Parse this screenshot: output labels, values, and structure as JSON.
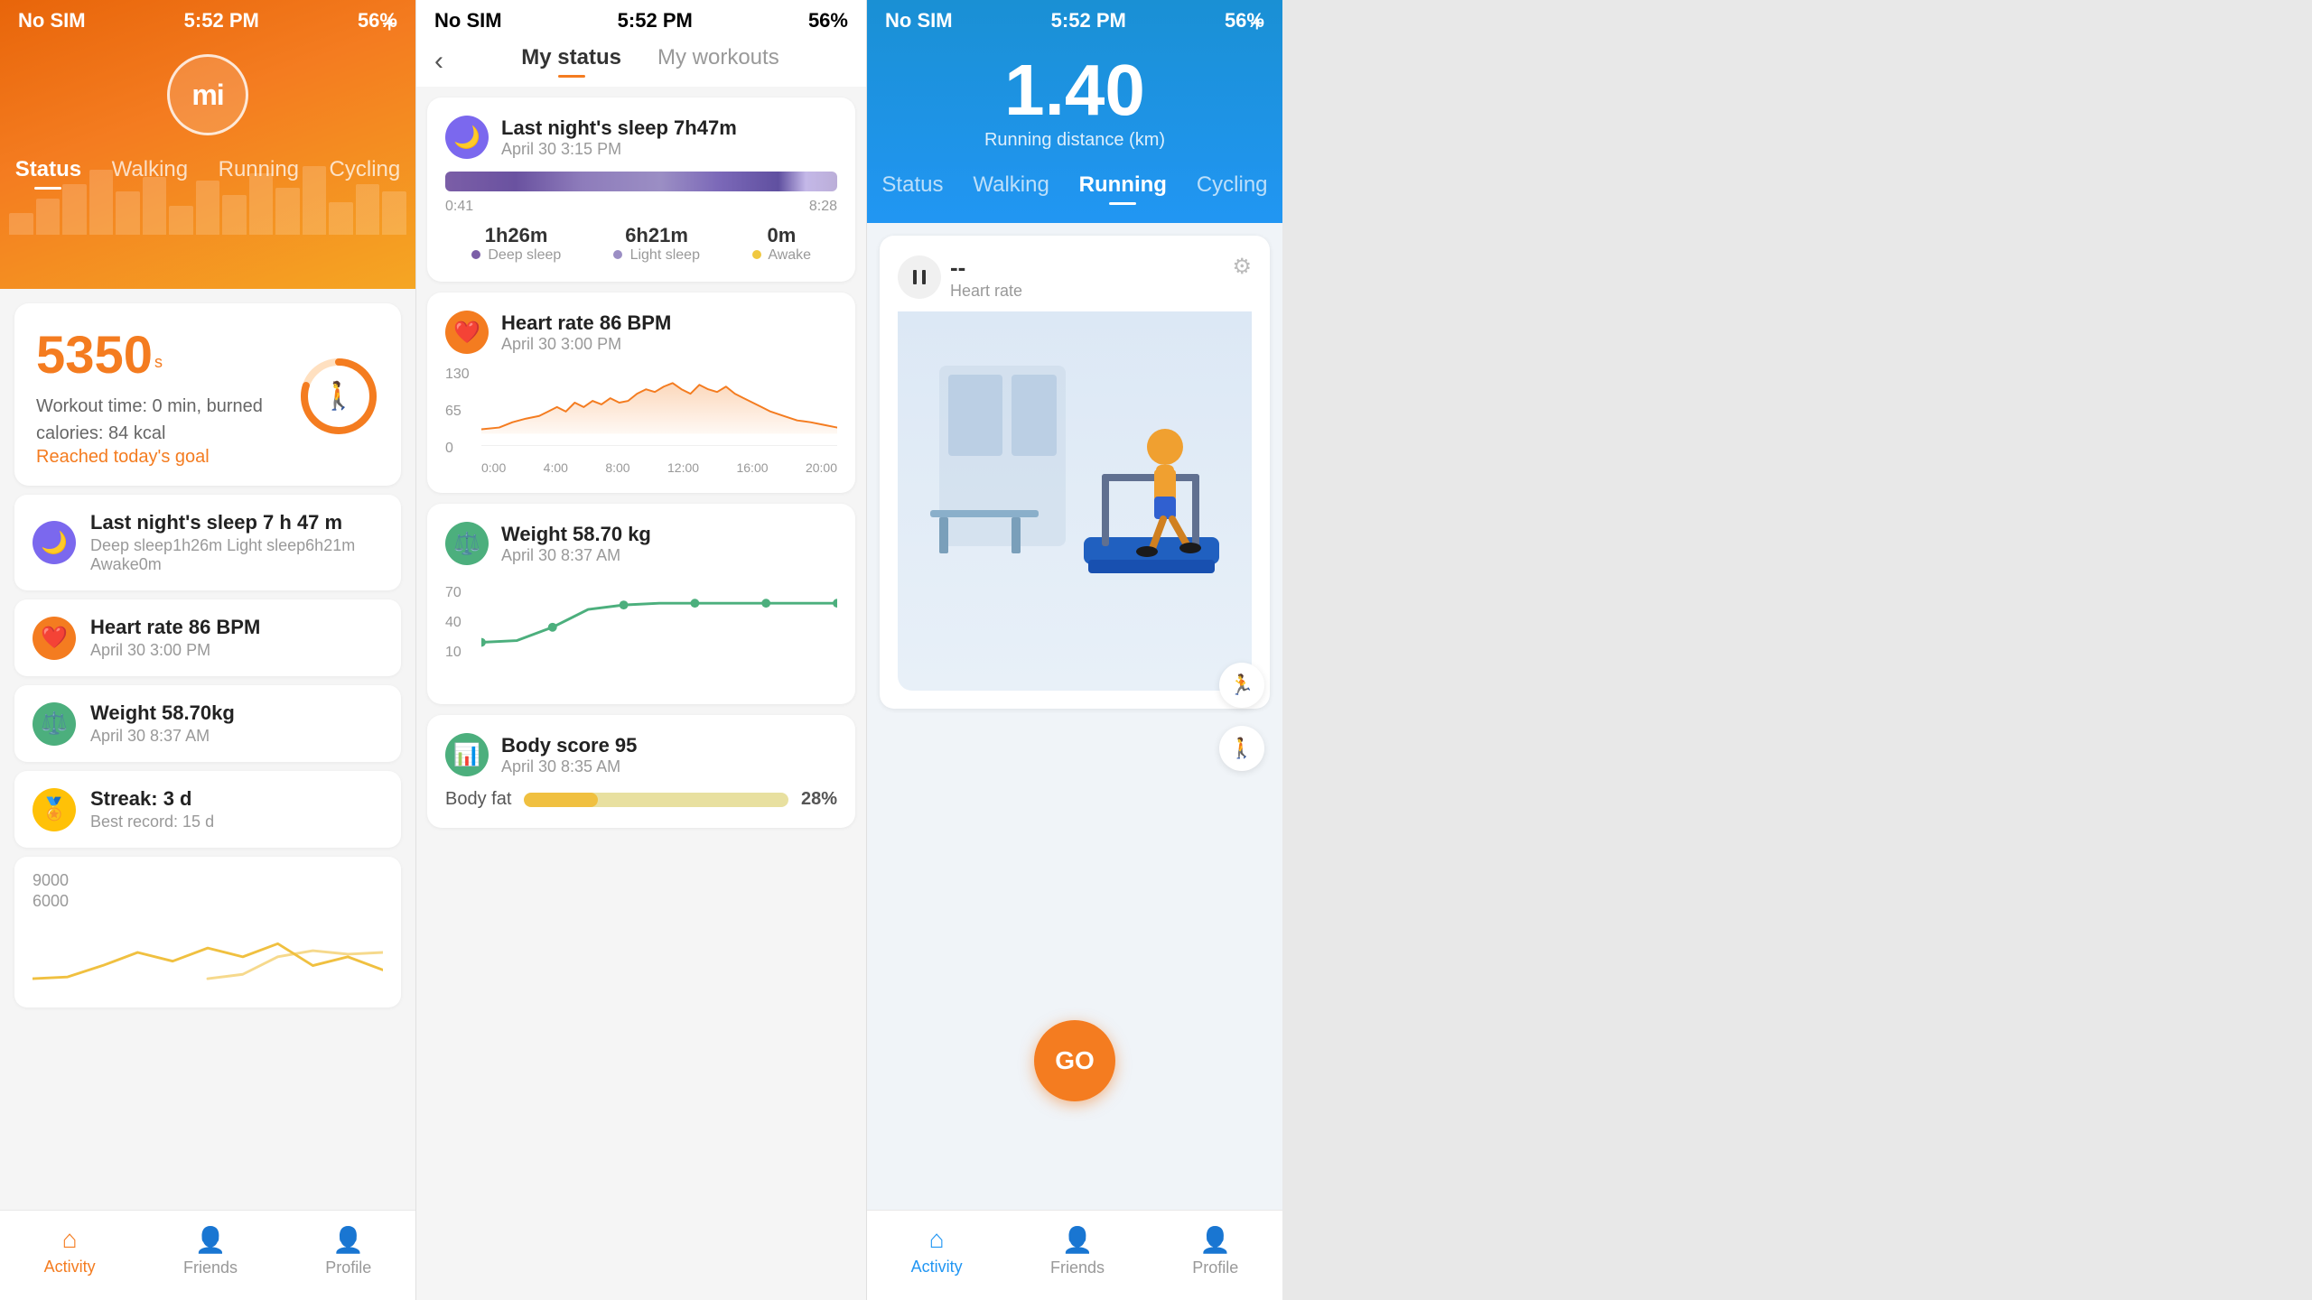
{
  "statusBar": {
    "carrier": "No SIM",
    "time": "5:52 PM",
    "batteryPct": "56%"
  },
  "panel1": {
    "logo": "mi",
    "addIcon": "+",
    "tabs": [
      "Status",
      "Walking",
      "Running",
      "Cycling"
    ],
    "activeTab": "Status",
    "steps": {
      "count": "5350",
      "unit": "s",
      "workoutInfo": "Workout time: 0 min, burned calories: 84 kcal",
      "goal": "Reached today's goal",
      "ringProgress": 80
    },
    "sleepItem": {
      "title": "Last night's sleep 7 h 47 m",
      "sub": "Deep sleep1h26m Light sleep6h21m Awake0m"
    },
    "heartItem": {
      "title": "Heart rate 86 BPM",
      "sub": "April 30 3:00 PM"
    },
    "weightItem": {
      "title": "Weight 58.70kg",
      "sub": "April 30 8:37 AM"
    },
    "streakItem": {
      "title": "Streak: 3 d",
      "sub": "Best record: 15 d"
    },
    "chartLabels": [
      "9000",
      "6000"
    ],
    "nav": {
      "activity": "Activity",
      "friends": "Friends",
      "profile": "Profile"
    }
  },
  "panel2": {
    "title": "My status",
    "tab2": "My workouts",
    "sleep": {
      "title": "Last night's sleep 7h47m",
      "date": "April 30 3:15 PM",
      "timeStart": "0:41",
      "timeEnd": "8:28",
      "deepSleep": "1h26m",
      "lightSleep": "6h21m",
      "awake": "0m",
      "deepLabel": "Deep sleep",
      "lightLabel": "Light sleep",
      "awakeLabel": "Awake"
    },
    "heartRate": {
      "title": "Heart rate 86  BPM",
      "date": "April 30 3:00 PM",
      "yLabels": [
        "130",
        "65",
        "0"
      ],
      "xLabels": [
        "0:00",
        "4:00",
        "8:00",
        "12:00",
        "16:00",
        "20:00"
      ]
    },
    "weight": {
      "title": "Weight 58.70 kg",
      "date": "April 30 8:37 AM",
      "yLabels": [
        "70",
        "40",
        "10"
      ]
    },
    "bodyScore": {
      "title": "Body score 95",
      "date": "April 30 8:35 AM",
      "bodyFatLabel": "Body fat",
      "bodyFatPct": "28%",
      "bodyFatBarWidth": 28
    }
  },
  "panel3": {
    "distance": "1.40",
    "distanceLabel": "Running distance (km)",
    "tabs": [
      "Status",
      "Walking",
      "Running",
      "Cycling"
    ],
    "activeTab": "Running",
    "heartRate": {
      "label": "Heart rate",
      "value": "--"
    },
    "goButton": "GO",
    "nav": {
      "activity": "Activity",
      "friends": "Friends",
      "profile": "Profile"
    }
  }
}
